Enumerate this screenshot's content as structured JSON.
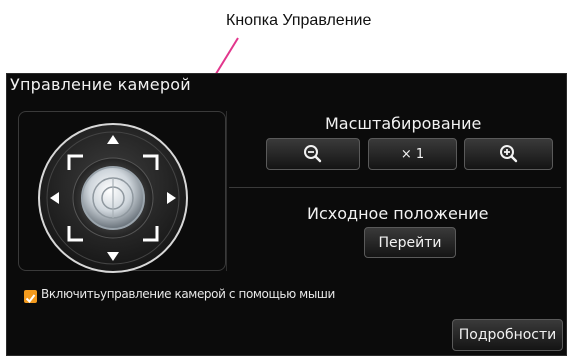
{
  "callout": {
    "label": "Кнопка Управление"
  },
  "panel": {
    "title": "Управление камерой",
    "zoom": {
      "label": "Масштабирование",
      "level": "× 1",
      "zoom_out_icon": "zoom-out-icon",
      "zoom_in_icon": "zoom-in-icon"
    },
    "home": {
      "label": "Исходное положение",
      "button": "Перейти"
    },
    "mouse_control": {
      "checked": true,
      "label": "Включитьуправление камерой с помощью мыши"
    },
    "details_button": "Подробности"
  },
  "colors": {
    "panel_bg": "#0b0b0b",
    "accent_pink": "#e2368c",
    "checkbox_orange": "#f29a1e"
  }
}
